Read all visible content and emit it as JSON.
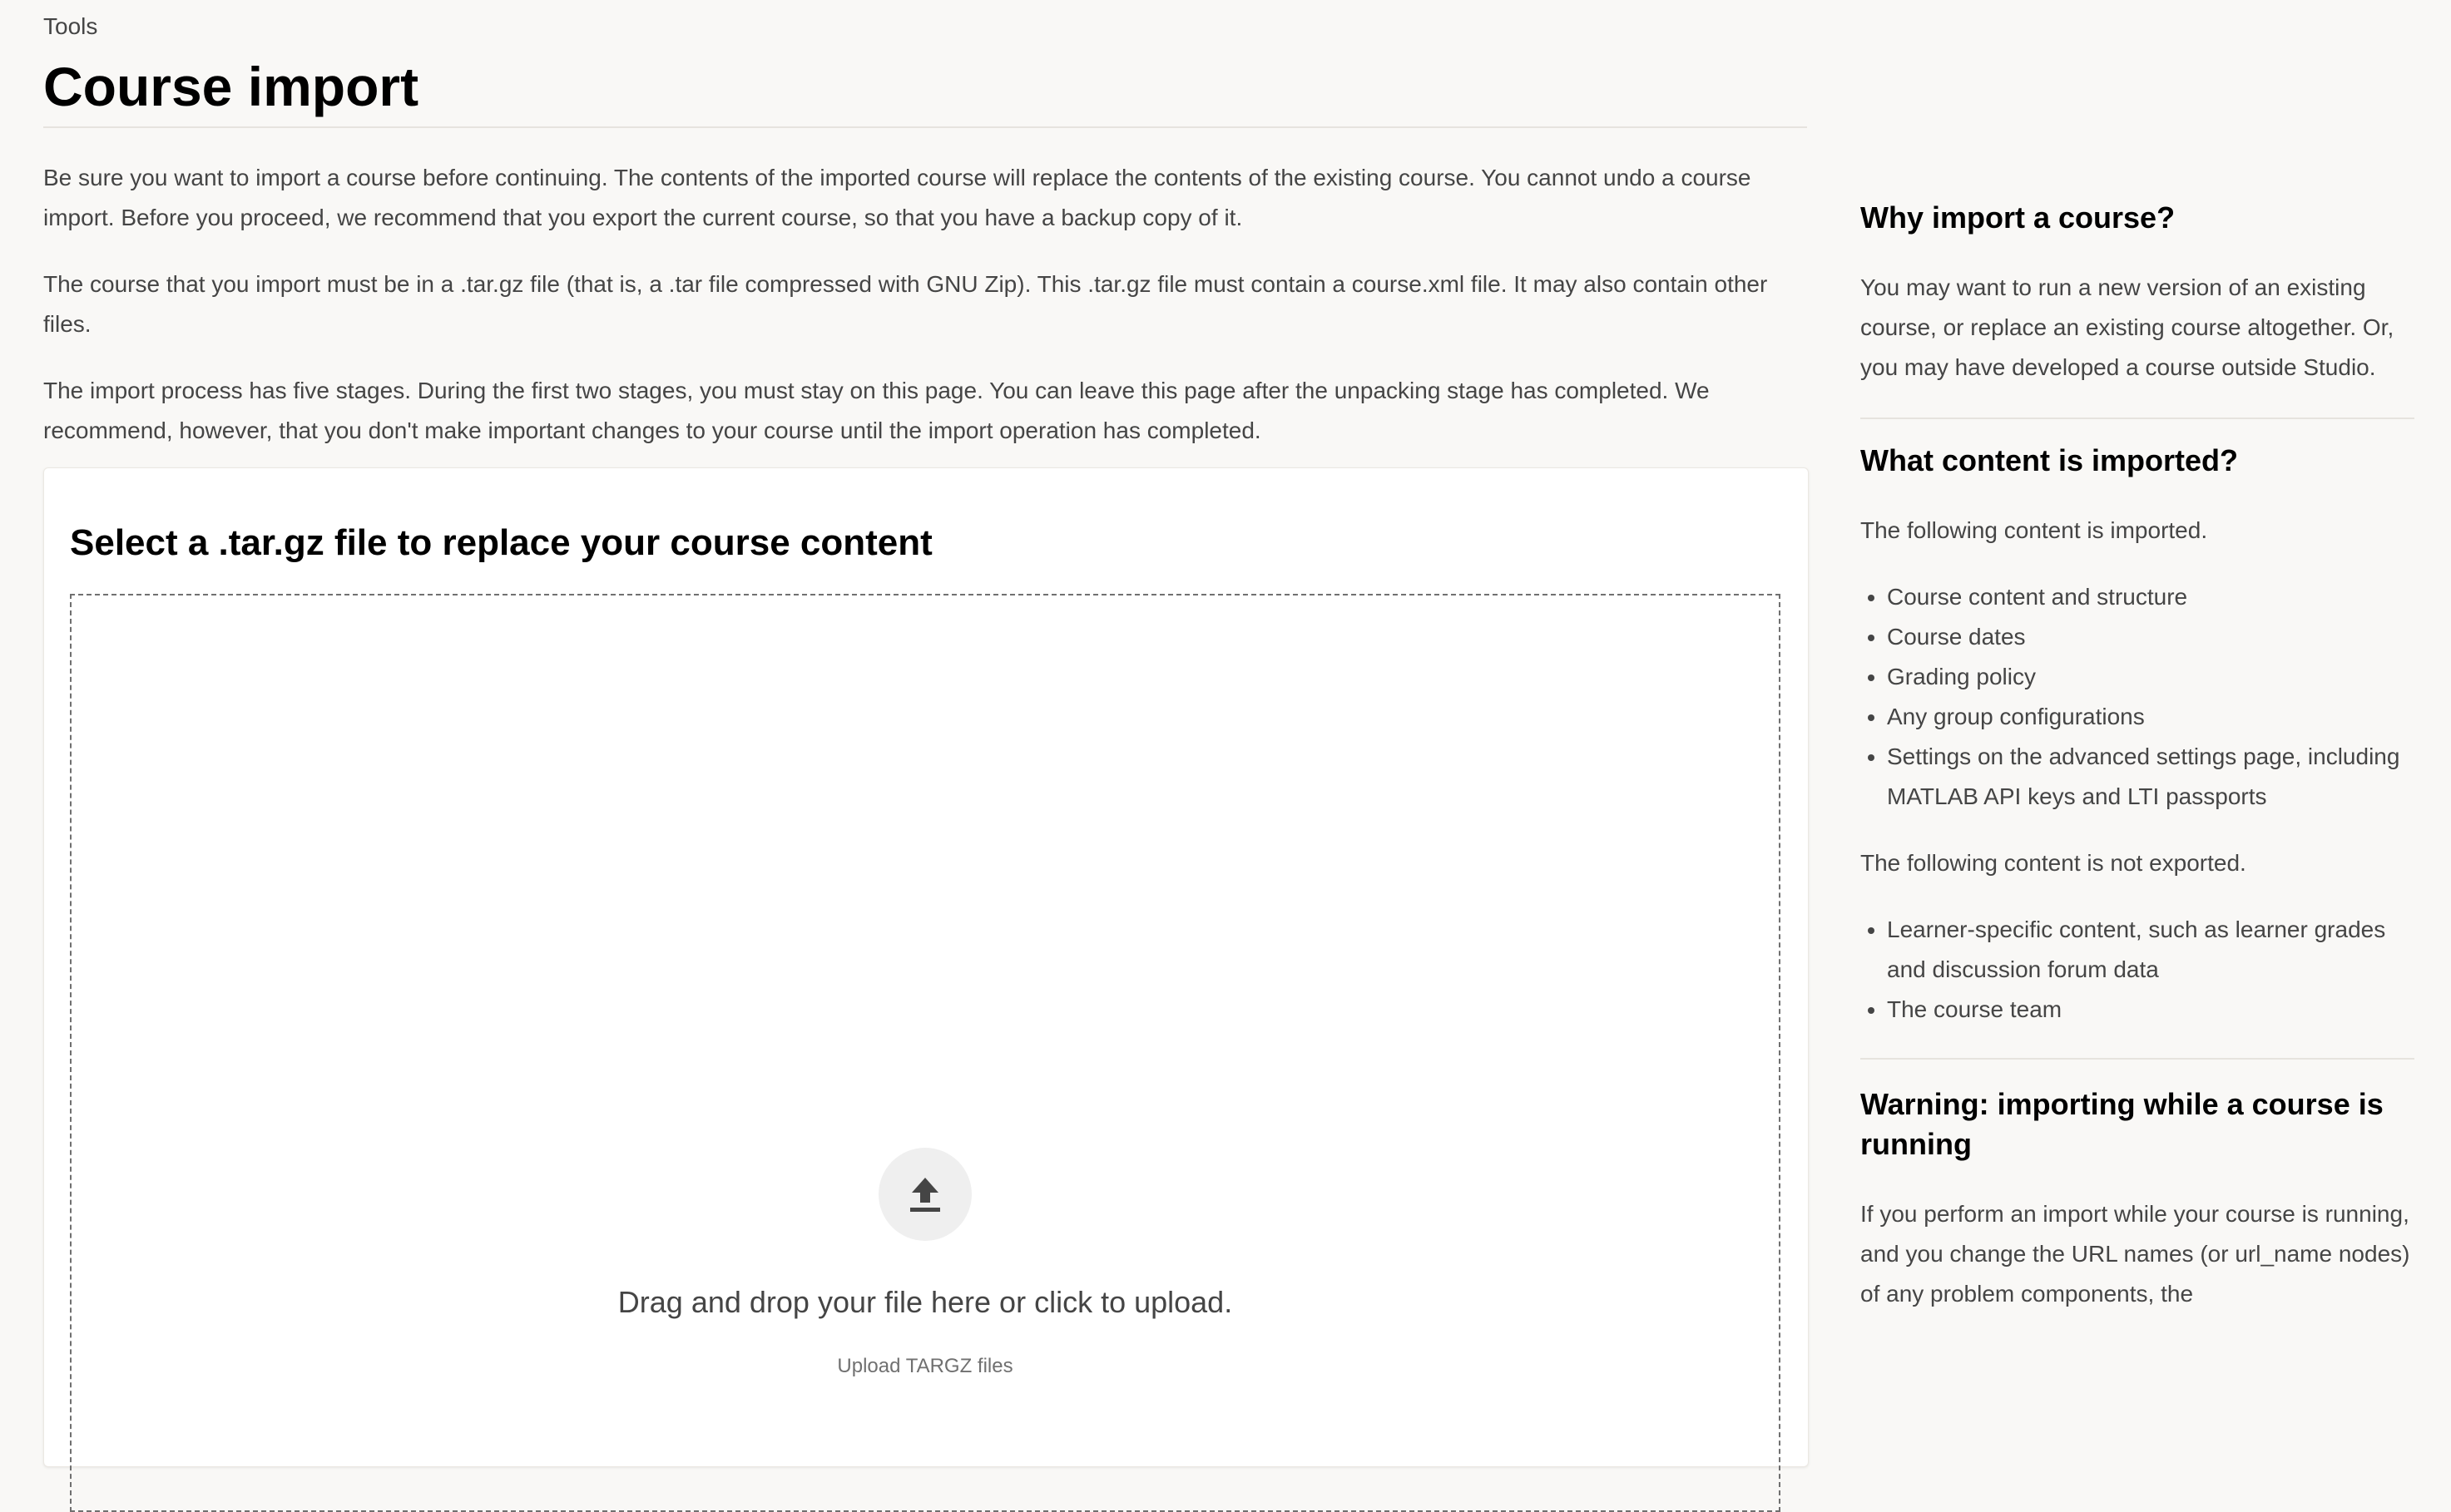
{
  "breadcrumb": "Tools",
  "page_title": "Course import",
  "intro": {
    "p1": "Be sure you want to import a course before continuing. The contents of the imported course will replace the contents of the existing course. You cannot undo a course import. Before you proceed, we recommend that you export the current course, so that you have a backup copy of it.",
    "p2": "The course that you import must be in a .tar.gz file (that is, a .tar file compressed with GNU Zip). This .tar.gz file must contain a course.xml file. It may also contain other files.",
    "p3": "The import process has five stages. During the first two stages, you must stay on this page. You can leave this page after the unpacking stage has completed. We recommend, however, that you don't make important changes to your course until the import operation has completed."
  },
  "upload_card": {
    "title": "Select a .tar.gz file to replace your course content",
    "icon": "upload-icon",
    "drop_text": "Drag and drop your file here or click to upload.",
    "sub_text": "Upload TARGZ files"
  },
  "sidebar": {
    "why": {
      "heading": "Why import a course?",
      "text": "You may want to run a new version of an existing course, or replace an existing course altogether. Or, you may have developed a course outside Studio."
    },
    "what": {
      "heading": "What content is imported?",
      "imported_intro": "The following content is imported.",
      "imported_items": [
        "Course content and structure",
        "Course dates",
        "Grading policy",
        "Any group configurations",
        "Settings on the advanced settings page, including MATLAB API keys and LTI passports"
      ],
      "not_intro": "The following content is not exported.",
      "not_items": [
        "Learner-specific content, such as learner grades and discussion forum data",
        "The course team"
      ]
    },
    "warning": {
      "heading": "Warning: importing while a course is running",
      "text": "If you perform an import while your course is running, and you change the URL names (or url_name nodes) of any problem components, the"
    }
  }
}
